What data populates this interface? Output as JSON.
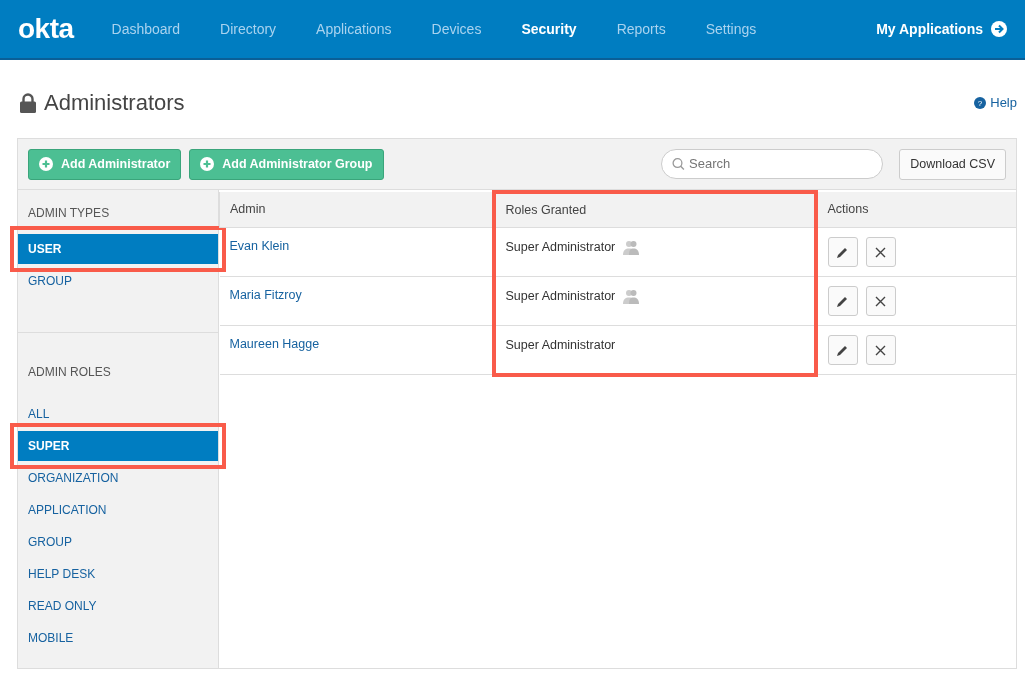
{
  "nav": {
    "logo": "okta",
    "items": [
      {
        "label": "Dashboard",
        "selected": false
      },
      {
        "label": "Directory",
        "selected": false
      },
      {
        "label": "Applications",
        "selected": false
      },
      {
        "label": "Devices",
        "selected": false
      },
      {
        "label": "Security",
        "selected": true
      },
      {
        "label": "Reports",
        "selected": false
      },
      {
        "label": "Settings",
        "selected": false
      }
    ],
    "my_apps": "My Applications"
  },
  "page": {
    "title": "Administrators",
    "help_icon": "?",
    "help": "Help"
  },
  "toolbar": {
    "buttons": [
      "Add Administrator",
      "Add Administrator Group"
    ],
    "search": {
      "placeholder": "Search"
    },
    "download": "Download CSV"
  },
  "sidebar": {
    "sections": [
      {
        "heading": "ADMIN TYPES",
        "items": [
          {
            "label": "USER",
            "selected": true,
            "highlighted": true
          },
          {
            "label": "GROUP",
            "selected": false,
            "highlighted": false
          }
        ]
      },
      {
        "heading": "ADMIN ROLES",
        "items": [
          {
            "label": "ALL",
            "selected": false,
            "highlighted": false
          },
          {
            "label": "SUPER",
            "selected": true,
            "highlighted": true
          },
          {
            "label": "ORGANIZATION",
            "selected": false,
            "highlighted": false
          },
          {
            "label": "APPLICATION",
            "selected": false,
            "highlighted": false
          },
          {
            "label": "GROUP",
            "selected": false,
            "highlighted": false
          },
          {
            "label": "HELP DESK",
            "selected": false,
            "highlighted": false
          },
          {
            "label": "READ ONLY",
            "selected": false,
            "highlighted": false
          },
          {
            "label": "MOBILE",
            "selected": false,
            "highlighted": false
          }
        ]
      }
    ]
  },
  "table": {
    "columns": [
      {
        "label": "Admin",
        "highlighted": false
      },
      {
        "label": "Roles Granted",
        "highlighted": true
      },
      {
        "label": "Actions",
        "highlighted": false
      }
    ],
    "rows": [
      {
        "admin": "Evan Klein",
        "role": "Super Administrator",
        "group_role": true
      },
      {
        "admin": "Maria Fitzroy",
        "role": "Super Administrator",
        "group_role": true
      },
      {
        "admin": "Maureen Hagge",
        "role": "Super Administrator",
        "group_role": false
      }
    ]
  }
}
